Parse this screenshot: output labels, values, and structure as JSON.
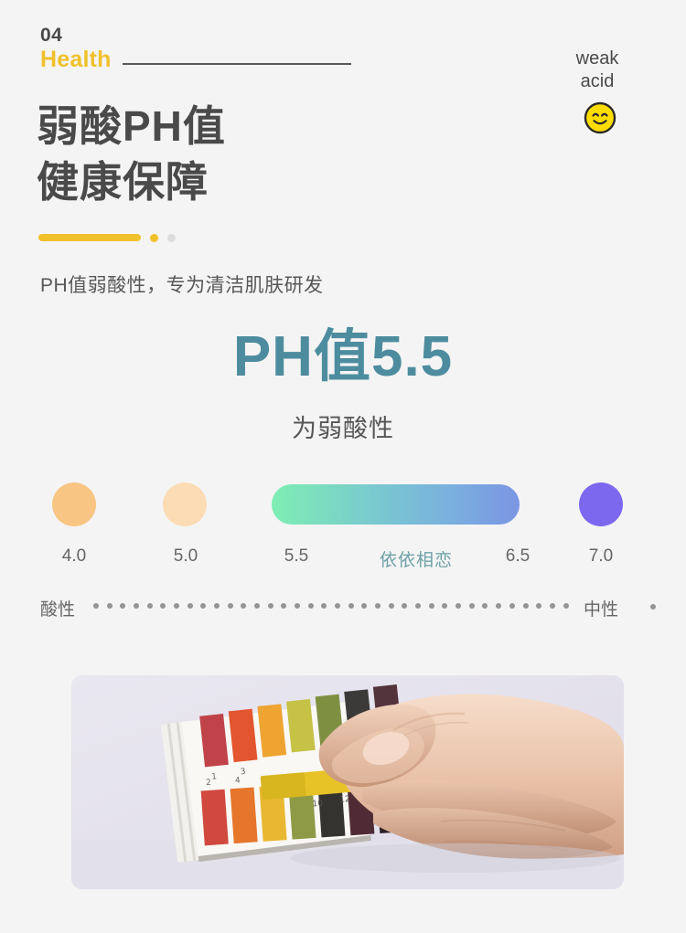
{
  "section": {
    "number": "04",
    "keyword": "Health"
  },
  "badge": {
    "line1": "weak",
    "line2": "acid",
    "icon": "smiley-face-icon"
  },
  "headline": {
    "line1": "弱酸PH值",
    "line2": "健康保障"
  },
  "subtitle": "PH值弱酸性，专为清洁肌肤研发",
  "ph": {
    "value_text": "PH值5.5",
    "caption": "为弱酸性"
  },
  "scale": {
    "labels": [
      "4.0",
      "5.0",
      "5.5",
      "依依相恋",
      "6.5",
      "7.0"
    ],
    "brand_label": "依依相恋",
    "axis_left": "酸性",
    "axis_right": "中性",
    "dot_count": 36,
    "swatches": [
      {
        "name": "ph-4-swatch",
        "color": "#f9c583"
      },
      {
        "name": "ph-5-swatch",
        "color": "#fbdcb4"
      },
      {
        "name": "ph-range-bar",
        "color_start": "#7eeeb3",
        "color_end": "#7b95e3"
      },
      {
        "name": "ph-7-swatch",
        "color": "#7c68ee"
      }
    ]
  },
  "photo": {
    "alt": "hand holding pH test strips against color chart"
  },
  "colors": {
    "background": "#f4f4f4",
    "accent_yellow": "#f0c12b",
    "teal": "#4d8c9f",
    "text_dark": "#4a4a4a",
    "text_muted": "#666666"
  }
}
